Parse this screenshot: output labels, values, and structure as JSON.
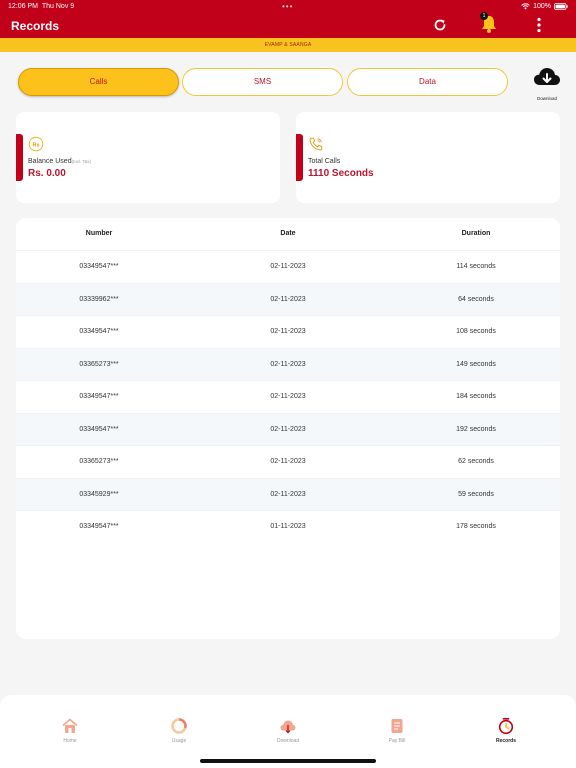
{
  "status_bar": {
    "time": "12:06 PM",
    "date": "Thu Nov 9",
    "battery": "100%"
  },
  "header": {
    "title": "Records",
    "notification_count": "1"
  },
  "brand": {
    "text": "EVAMP & SAANGA"
  },
  "tabs": [
    {
      "label": "Calls",
      "active": true
    },
    {
      "label": "SMS",
      "active": false
    },
    {
      "label": "Data",
      "active": false
    }
  ],
  "download": {
    "label": "Download"
  },
  "cards": {
    "balance": {
      "label": "Balance Used",
      "sublabel": "(Incl. Tax)",
      "value": "Rs. 0.00",
      "icon": "rupee-icon"
    },
    "calls": {
      "label": "Total Calls",
      "value": "1110 Seconds",
      "icon": "phone-icon"
    }
  },
  "table": {
    "headers": [
      "Number",
      "Date",
      "Duration"
    ],
    "rows": [
      [
        "03349547***",
        "02-11-2023",
        "114 seconds"
      ],
      [
        "03339962***",
        "02-11-2023",
        "64 seconds"
      ],
      [
        "03349547***",
        "02-11-2023",
        "108 seconds"
      ],
      [
        "03365273***",
        "02-11-2023",
        "149 seconds"
      ],
      [
        "03349547***",
        "02-11-2023",
        "184 seconds"
      ],
      [
        "03349547***",
        "02-11-2023",
        "192 seconds"
      ],
      [
        "03365273***",
        "02-11-2023",
        "62 seconds"
      ],
      [
        "03345929***",
        "02-11-2023",
        "59 seconds"
      ],
      [
        "03349547***",
        "01-11-2023",
        "178 seconds"
      ]
    ]
  },
  "bottom_nav": [
    {
      "label": "Home",
      "icon": "home-icon",
      "active": false
    },
    {
      "label": "Usage",
      "icon": "usage-icon",
      "active": false
    },
    {
      "label": "Download",
      "icon": "cloud-download-icon",
      "active": false
    },
    {
      "label": "Pay Bill",
      "icon": "bill-icon",
      "active": false
    },
    {
      "label": "Records",
      "icon": "records-icon",
      "active": true
    }
  ],
  "colors": {
    "primary": "#c1001a",
    "accent": "#fcc21b",
    "text_red": "#b8162c"
  }
}
